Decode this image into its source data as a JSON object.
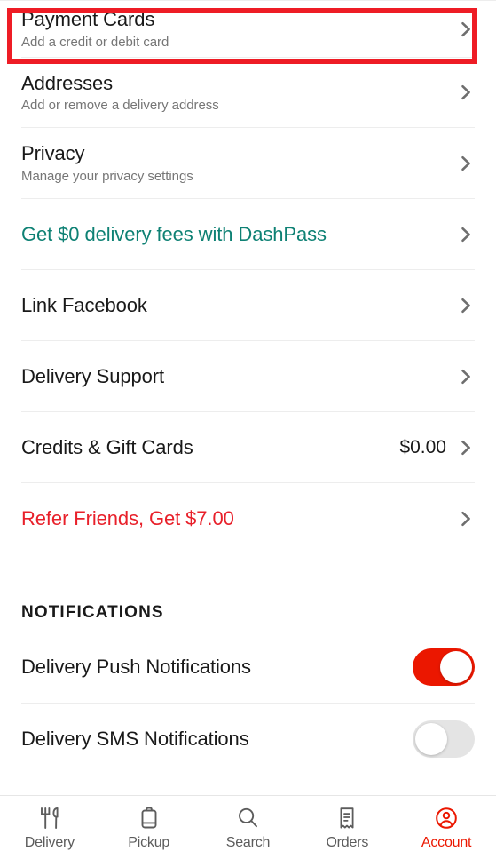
{
  "colors": {
    "accent_red": "#eb1700",
    "annotation_red": "#ee1c25",
    "teal": "#0e8174",
    "refer_red": "#e8202a",
    "text_primary": "#191919",
    "text_secondary": "#767676",
    "divider": "#ededed",
    "toggle_off": "#e4e4e4"
  },
  "settings_rows": [
    {
      "name": "payment-cards",
      "title": "Payment Cards",
      "subtitle": "Add a credit or debit card",
      "value": "",
      "style": "default",
      "chevron": "chevron-right-icon",
      "highlighted": true
    },
    {
      "name": "addresses",
      "title": "Addresses",
      "subtitle": "Add or remove a delivery address",
      "value": "",
      "style": "default",
      "chevron": "chevron-right-icon",
      "highlighted": false
    },
    {
      "name": "privacy",
      "title": "Privacy",
      "subtitle": "Manage your privacy settings",
      "value": "",
      "style": "default",
      "chevron": "chevron-right-icon",
      "highlighted": false
    },
    {
      "name": "dashpass",
      "title": "Get $0 delivery fees with DashPass",
      "subtitle": "",
      "value": "",
      "style": "teal",
      "chevron": "chevron-right-icon",
      "highlighted": false
    },
    {
      "name": "link-facebook",
      "title": "Link Facebook",
      "subtitle": "",
      "value": "",
      "style": "default",
      "chevron": "chevron-right-icon",
      "highlighted": false
    },
    {
      "name": "delivery-support",
      "title": "Delivery Support",
      "subtitle": "",
      "value": "",
      "style": "default",
      "chevron": "chevron-right-icon",
      "highlighted": false
    },
    {
      "name": "credits-gift-cards",
      "title": "Credits & Gift Cards",
      "subtitle": "",
      "value": "$0.00",
      "style": "default",
      "chevron": "chevron-right-icon",
      "highlighted": false
    },
    {
      "name": "refer-friends",
      "title": "Refer Friends, Get $7.00",
      "subtitle": "",
      "value": "",
      "style": "redlink",
      "chevron": "chevron-right-icon",
      "highlighted": false
    }
  ],
  "notifications": {
    "heading": "NOTIFICATIONS",
    "rows": [
      {
        "name": "delivery-push-notifications",
        "title": "Delivery Push Notifications",
        "toggle": "on"
      },
      {
        "name": "delivery-sms-notifications",
        "title": "Delivery SMS Notifications",
        "toggle": "off"
      }
    ]
  },
  "bottom_nav": {
    "items": [
      {
        "name": "delivery",
        "label": "Delivery",
        "icon": "fork-knife-icon",
        "active": false
      },
      {
        "name": "pickup",
        "label": "Pickup",
        "icon": "shopping-bag-icon",
        "active": false
      },
      {
        "name": "search",
        "label": "Search",
        "icon": "search-icon",
        "active": false
      },
      {
        "name": "orders",
        "label": "Orders",
        "icon": "receipt-icon",
        "active": false
      },
      {
        "name": "account",
        "label": "Account",
        "icon": "account-circle-icon",
        "active": true
      }
    ]
  }
}
